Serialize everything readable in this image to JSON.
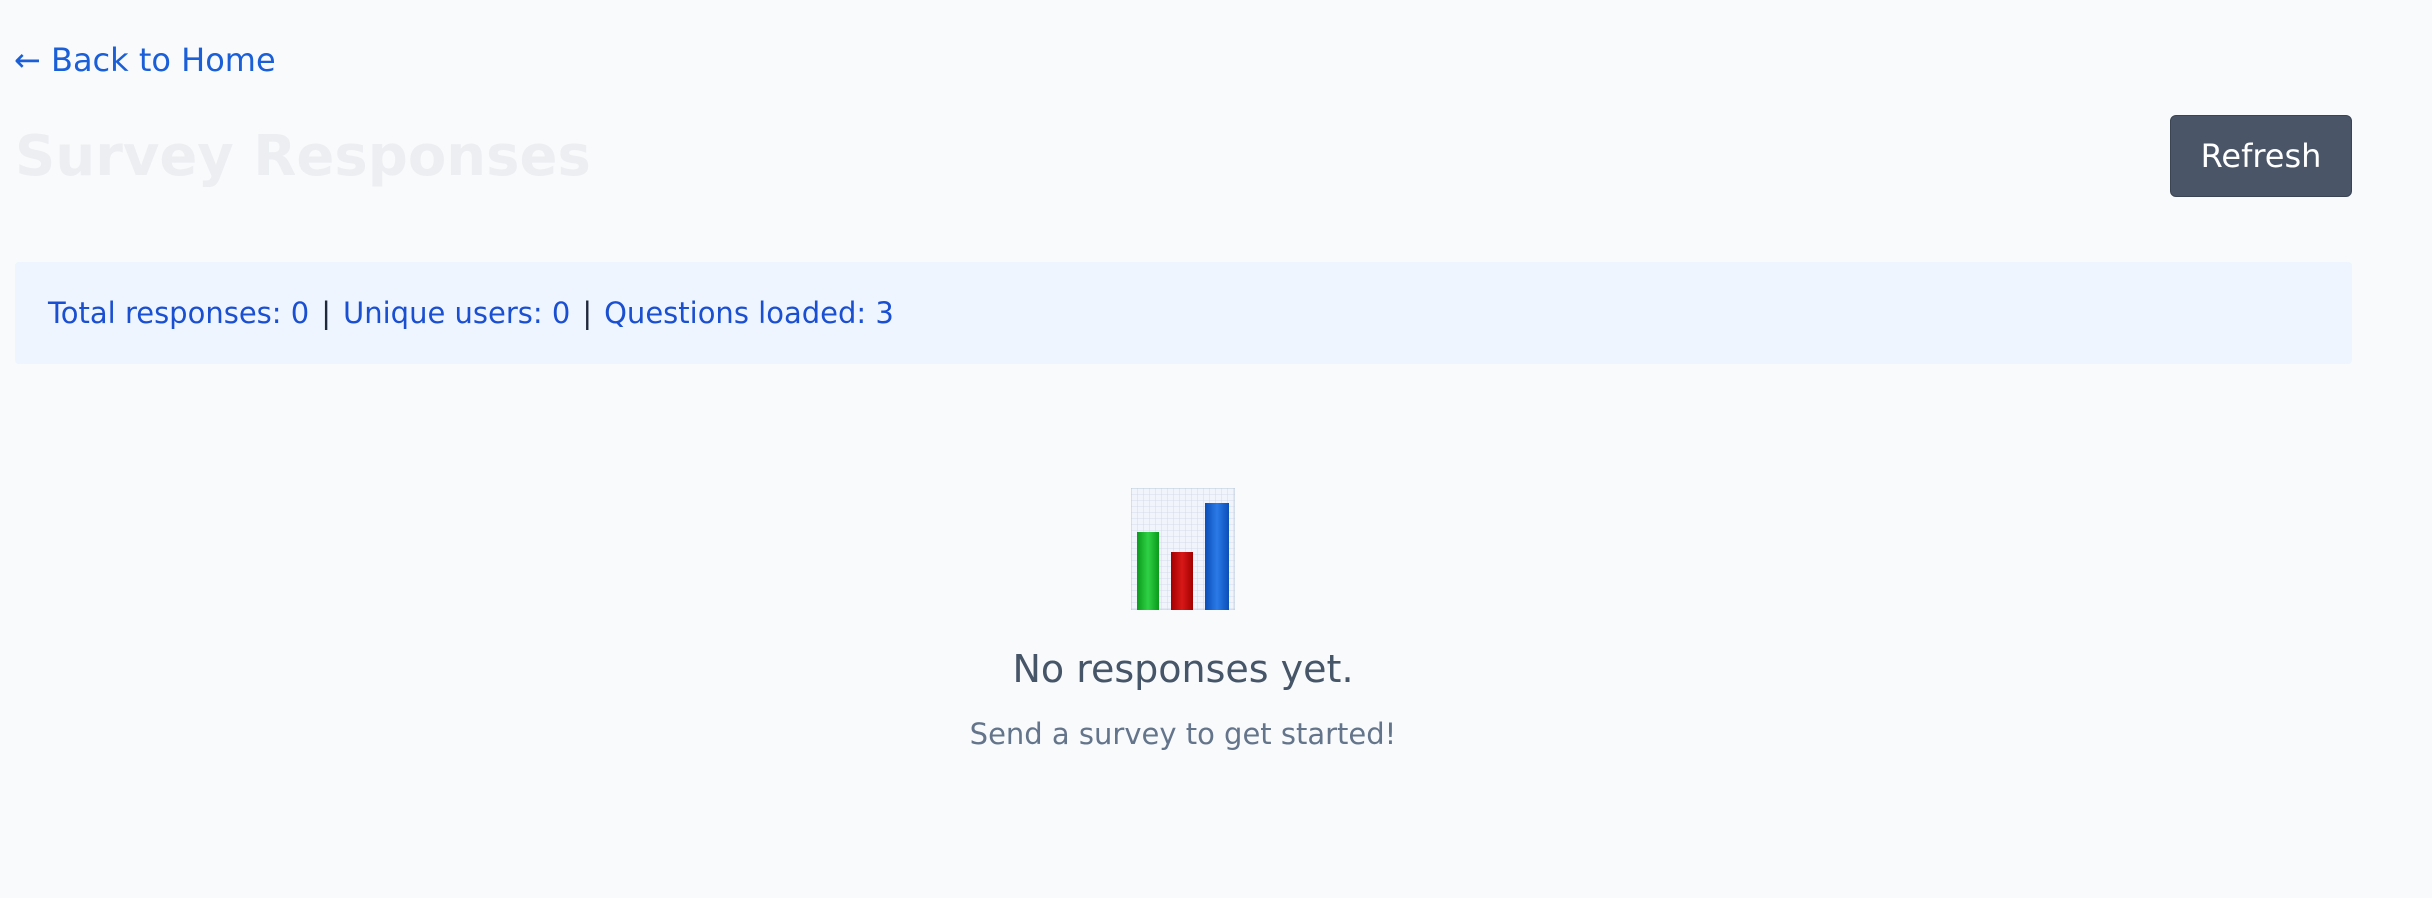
{
  "nav": {
    "back_label": "← Back to Home"
  },
  "header": {
    "title": "Survey Responses",
    "refresh_label": "Refresh"
  },
  "stats": {
    "total": "Total responses: 0",
    "unique": "Unique users: 0",
    "questions": "Questions loaded: 3",
    "separator": "|"
  },
  "empty_state": {
    "icon": "bar-chart-icon",
    "title": "No responses yet.",
    "subtitle": "Send a survey to get started!"
  },
  "colors": {
    "background": "#f8fafc",
    "link": "#1a5fd8",
    "button_bg": "#4a5568",
    "stats_bg": "#eef5fe",
    "stats_text": "#1a4fd1"
  }
}
